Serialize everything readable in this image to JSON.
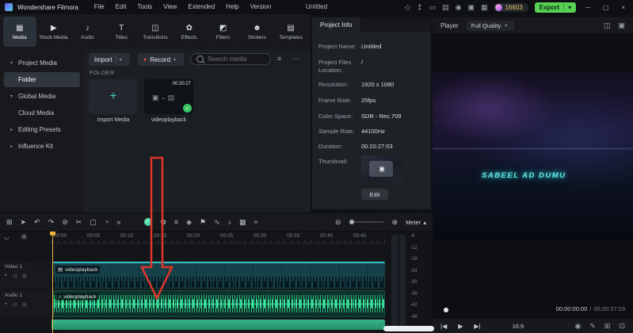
{
  "titlebar": {
    "app_name": "Wondershare Filmora",
    "menus": [
      "File",
      "Edit",
      "Tools",
      "View",
      "Extended",
      "Help",
      "Version"
    ],
    "document_title": "Untitled",
    "coin_count": "16603",
    "export_label": "Export"
  },
  "tabbar": {
    "tabs": [
      {
        "label": "Media",
        "glyph": "▦"
      },
      {
        "label": "Stock Media",
        "glyph": "▶"
      },
      {
        "label": "Audio",
        "glyph": "♪"
      },
      {
        "label": "Titles",
        "glyph": "T"
      },
      {
        "label": "Transitions",
        "glyph": "◫"
      },
      {
        "label": "Effects",
        "glyph": "✿"
      },
      {
        "label": "Filters",
        "glyph": "◩"
      },
      {
        "label": "Stickers",
        "glyph": "☻"
      },
      {
        "label": "Templates",
        "glyph": "▤"
      }
    ]
  },
  "sidebar": {
    "items": [
      {
        "label": "Project Media",
        "chevron": "▾"
      },
      {
        "label": "Folder",
        "chevron": ""
      },
      {
        "label": "Global Media",
        "chevron": "▾"
      },
      {
        "label": "Cloud Media",
        "chevron": ""
      },
      {
        "label": "Editing Presets",
        "chevron": "▸"
      },
      {
        "label": "Influence Kit",
        "chevron": "▸"
      }
    ]
  },
  "media": {
    "import_button": "Import",
    "record_button": "Record",
    "search_placeholder": "Search media",
    "section_label": "FOLDER",
    "import_tile_label": "Import Media",
    "clip_tile_label": "videoplayback",
    "clip_duration": "00:20:27"
  },
  "project_info": {
    "title": "Project Info",
    "fields": [
      {
        "label": "Project Name:",
        "value": "Untitled"
      },
      {
        "label": "Project Files Location:",
        "value": "/"
      },
      {
        "label": "Resolution:",
        "value": "1920 x 1080"
      },
      {
        "label": "Frame Rate:",
        "value": "25fps"
      },
      {
        "label": "Color Space:",
        "value": "SDR - Rec.709"
      },
      {
        "label": "Sample Rate:",
        "value": "44100Hz"
      },
      {
        "label": "Duration:",
        "value": "00:20:27:03"
      },
      {
        "label": "Thumbnail:",
        "value": ""
      }
    ],
    "edit_button": "Edit"
  },
  "player": {
    "title": "Player",
    "quality": "Full Quality",
    "overlay_text": "SABEEL AD DUMU",
    "current_time": "00:00:00:00",
    "separator": "/",
    "total_time": "00:20:27:03",
    "aspect_ratio": "16:9"
  },
  "toolbar": {
    "meter_label": "Meter"
  },
  "timeline": {
    "ruler": [
      "00:00",
      "00:05",
      "00:10",
      "00:15",
      "00:20",
      "00:25",
      "00:30",
      "00:35",
      "00:40",
      "00:45"
    ],
    "tracks": [
      {
        "name": "Video 1",
        "clip": "videoplayback"
      },
      {
        "name": "Audio 1",
        "clip": "videoplayback"
      }
    ]
  },
  "meter": {
    "scale": [
      "-6",
      "-12",
      "-18",
      "-24",
      "-30",
      "-36",
      "-42",
      "-48"
    ]
  },
  "icons": {
    "dropdown": "▾",
    "record_dot": "●",
    "more": "⋯",
    "filter": "≡",
    "check": "✓",
    "plus": "+",
    "camera": "▣",
    "film": "▤",
    "dash": "−",
    "promo": "◇",
    "share": "↥",
    "display": "▭",
    "keyboard": "▤",
    "record": "◉",
    "snapshot": "▣",
    "layout": "▦",
    "minimize": "─",
    "maximize": "▢",
    "close": "×",
    "panel": "⊞",
    "cursor": "➤",
    "undo": "↶",
    "redo": "↷",
    "trash": "⊘",
    "split": "✂",
    "crop": "▢",
    "speed": "◔",
    "more_tools": "»",
    "effects": "✿",
    "adjust": "≡",
    "keyframe": "◈",
    "marker": "⚑",
    "wave": "∿",
    "mic": "♪",
    "screen": "▦",
    "ramp": "≈",
    "zoom_out": "⊖",
    "zoom_in": "⊕",
    "caret_up": "▴",
    "snap": "◡",
    "add_track": "⊞",
    "lock": "▪",
    "mute": "◁",
    "eye": "◎",
    "prev": "|◀",
    "play": "▶",
    "next": "▶|",
    "pen": "✎",
    "grid": "⊞",
    "fullscreen": "⊡",
    "split_view": "◫",
    "bg_image": "▣"
  },
  "colors": {
    "accent_green": "#57d054",
    "accent_teal": "#35c3c8",
    "clip_video": "#16404a",
    "clip_audio": "#0d3229",
    "waveform_green": "#2ecf8f",
    "arrow_red": "#e0352b"
  }
}
